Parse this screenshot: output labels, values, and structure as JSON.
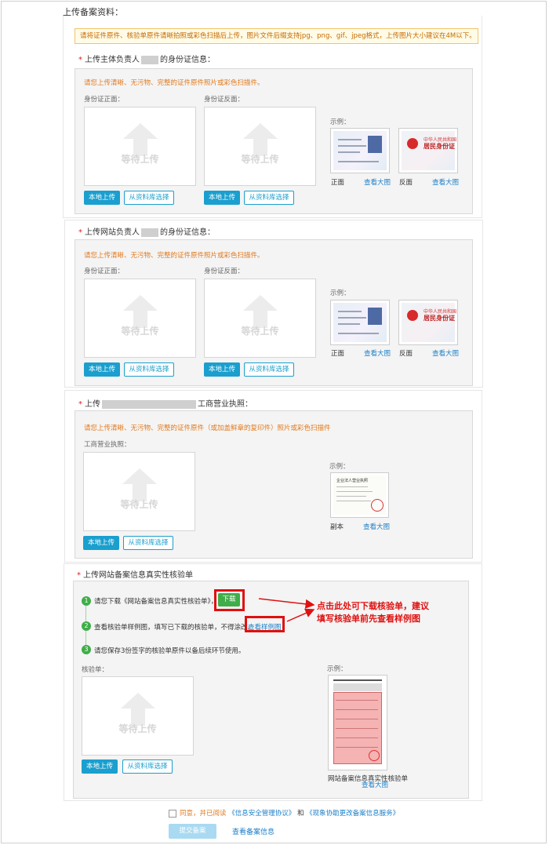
{
  "page_title": "上传备案资料：",
  "notice": "请将证件原件、核验单原件请晰拍照或彩色扫描后上传，图片文件后缀支持jpg、png、gif、jpeg格式，上传图片大小建议在4M以下。",
  "sections": [
    {
      "label_prefix": "上传主体负责人",
      "label_suffix": "的身份证信息：",
      "hint": "请您上传清晰、无污物、完整的证件原件照片或彩色扫描件。",
      "front_label": "身份证正面：",
      "back_label": "身份证反面：",
      "waiting": "等待上传",
      "local_upload": "本地上传",
      "from_library": "从资料库选择",
      "example": "示例：",
      "cap_front": "正面",
      "cap_back": "反面",
      "view_large": "查看大图"
    },
    {
      "label_prefix": "上传网站负责人",
      "label_suffix": "的身份证信息：",
      "hint": "请您上传清晰、无污物、完整的证件原件照片或彩色扫描件。",
      "front_label": "身份证正面：",
      "back_label": "身份证反面：",
      "waiting": "等待上传",
      "local_upload": "本地上传",
      "from_library": "从资料库选择",
      "example": "示例：",
      "cap_front": "正面",
      "cap_back": "反面",
      "view_large": "查看大图"
    }
  ],
  "license": {
    "label_prefix": "上传",
    "label_suffix": "工商营业执照：",
    "hint": "请您上传清晰、无污物、完整的证件原件（或加盖鲜章的复印件）照片或彩色扫描件",
    "field_label": "工商营业执照：",
    "waiting": "等待上传",
    "local_upload": "本地上传",
    "from_library": "从资料库选择",
    "example": "示例：",
    "caption": "副本",
    "view_large": "查看大图"
  },
  "verify": {
    "label": "上传网站备案信息真实性核验单",
    "step1_text": "请您下载《网站备案信息真实性核验单》，",
    "download": "下载",
    "step2_text": "查看核验单样例图，填写已下载的核验单，不得涂改。",
    "view_sample": "查看样例图",
    "step3_text": "请您保存3份签字的核验单原件以备后续环节使用。",
    "field_label": "核验单：",
    "waiting": "等待上传",
    "local_upload": "本地上传",
    "from_library": "从资料库选择",
    "example": "示例：",
    "caption": "网站备案信息真实性核验单",
    "view_large": "查看大图",
    "annotation_line1": "点击此处可下载核验单，建议",
    "annotation_line2": "填写核验单前先查看样例图"
  },
  "footer": {
    "agree_prefix": "同意，并已阅读",
    "agreement1": "《信息安全管理协议》",
    "and": "和",
    "agreement2": "《现象协助更改备案信息服务》",
    "submit": "提交备案",
    "view_info": "查看备案信息"
  },
  "colors": {
    "primary_blue": "#1a9fce",
    "green": "#3fae49",
    "red_annotation": "#e01010",
    "hint_orange": "#e07a1f"
  }
}
